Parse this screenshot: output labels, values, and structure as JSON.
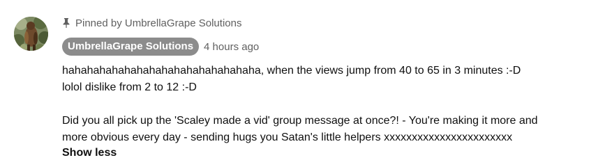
{
  "comment": {
    "pinned_label": "Pinned by UmbrellaGrape Solutions",
    "author": "UmbrellaGrape Solutions",
    "timestamp": "4 hours ago",
    "lines": [
      "hahahahahahahahahahahahahahahaha, when the views jump from 40 to 65 in 3 minutes :-D",
      "lolol  dislike from 2 to 12 :-D",
      "",
      "Did you all pick up the 'Scaley made a vid' group message at once?!  - You're making it more and",
      "more obvious every day - sending hugs you Satan's little helpers xxxxxxxxxxxxxxxxxxxxxxx"
    ],
    "show_less_label": "Show less"
  },
  "icons": {
    "avatar": "avatar-icon",
    "pin": "pin-icon"
  },
  "colors": {
    "author_chip_bg": "#8c8c8c",
    "muted_text": "#606060",
    "body_text": "#0f0f0f"
  }
}
